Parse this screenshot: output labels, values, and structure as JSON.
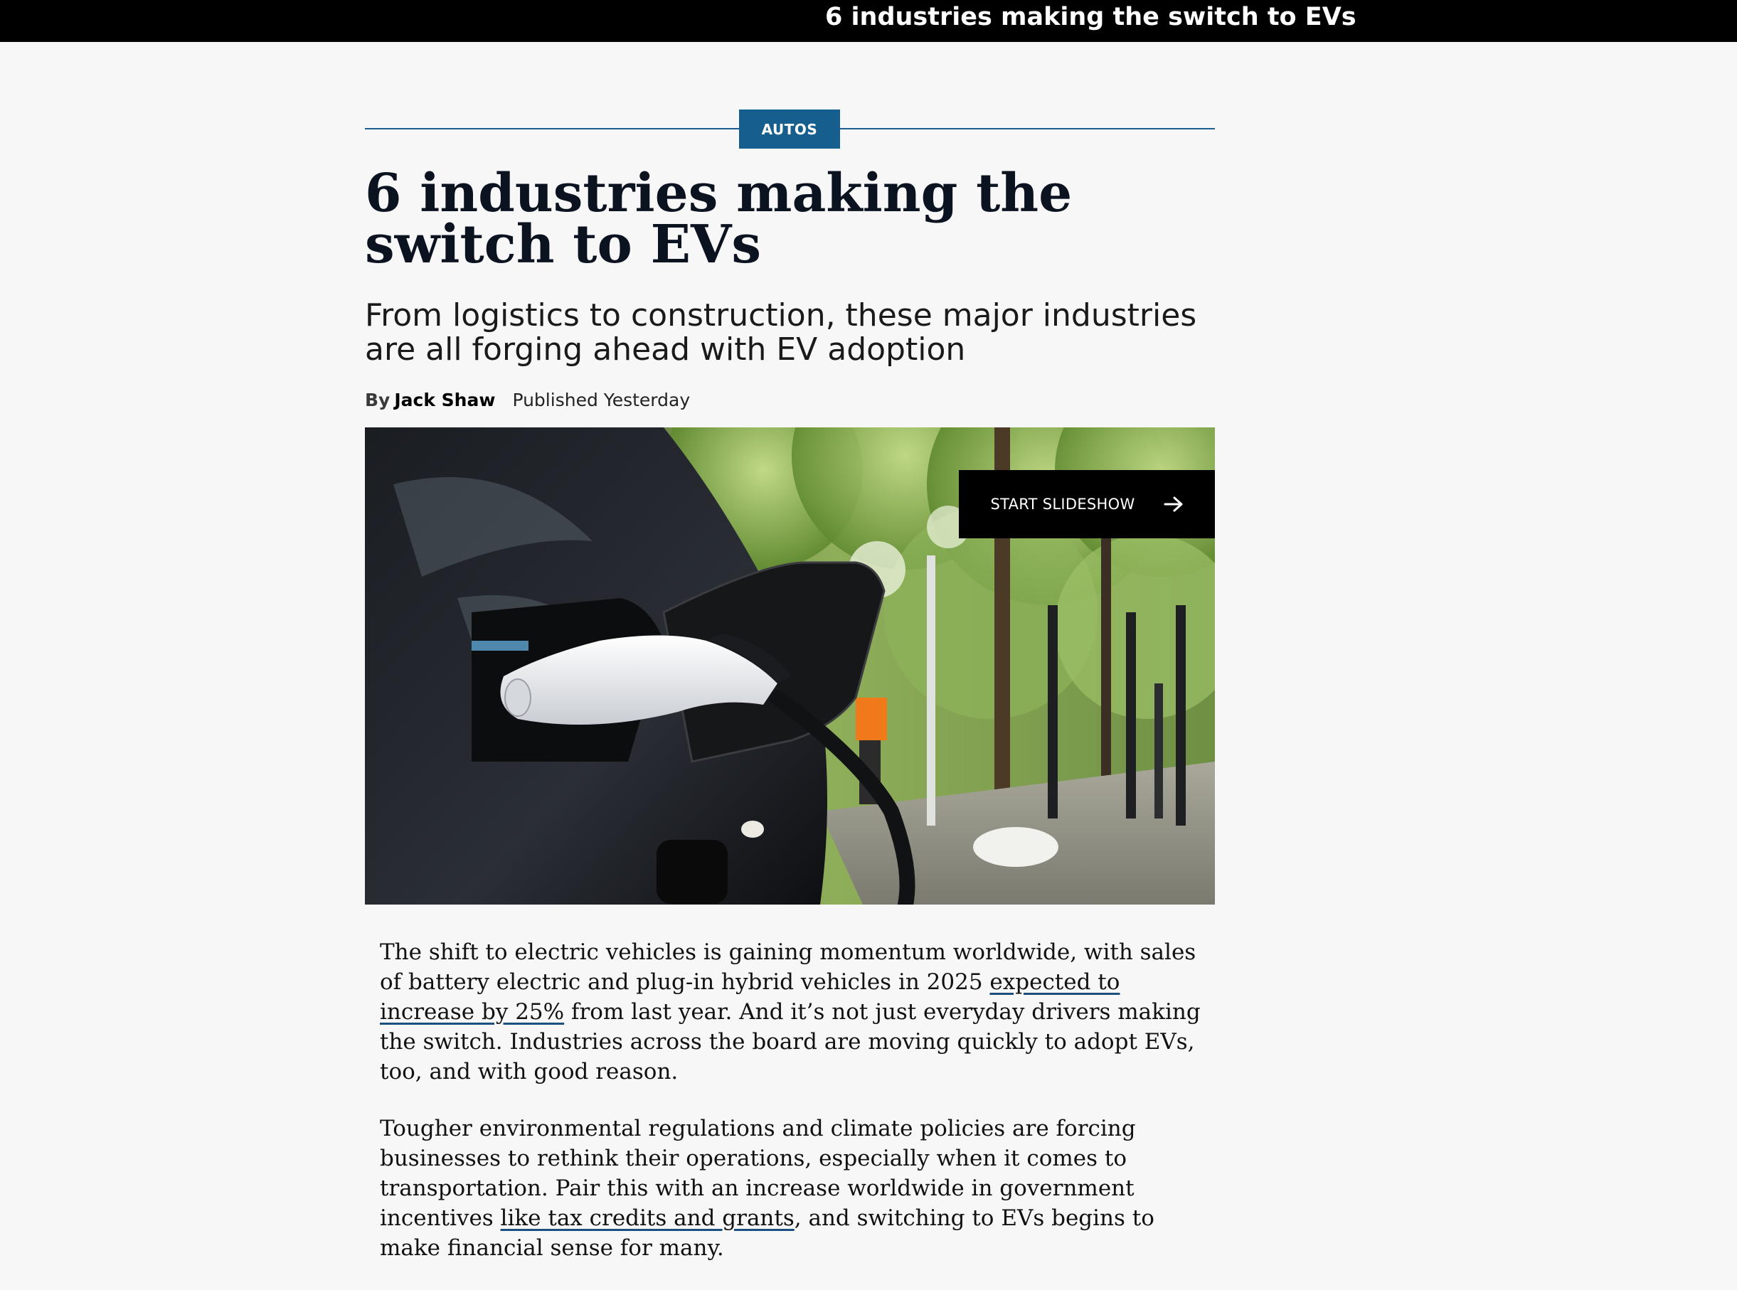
{
  "header": {
    "title": "6 industries making the switch to EVs"
  },
  "article": {
    "category": "AUTOS",
    "headline": "6 industries making the switch to EVs",
    "dek": "From logistics to construction, these major industries are all forging ahead with EV adoption",
    "byline": {
      "prefix": "By",
      "author": "Jack Shaw",
      "published": "Published Yesterday"
    },
    "hero": {
      "slideshow_label": "START SLIDESHOW",
      "slideshow_icon": "arrow-right-icon"
    },
    "paragraphs": [
      {
        "before": "The shift to electric vehicles is gaining momentum worldwide, with sales of battery electric and plug-in hybrid vehicles in 2025 ",
        "link": "expected to increase by 25%",
        "after": " from last year. And it’s not just everyday drivers making the switch. Industries across the board are moving quickly to adopt EVs, too, and with good reason."
      },
      {
        "before": "Tougher environmental regulations and climate policies are forcing businesses to rethink their operations, especially when it comes to transportation. Pair this with an increase worldwide in government incentives ",
        "link": "like tax credits and grants",
        "after": ", and switching to EVs begins to make financial sense for many."
      }
    ]
  },
  "colors": {
    "category_blue": "#155e8e",
    "topbar": "#000000",
    "page_bg": "#f7f7f7"
  }
}
